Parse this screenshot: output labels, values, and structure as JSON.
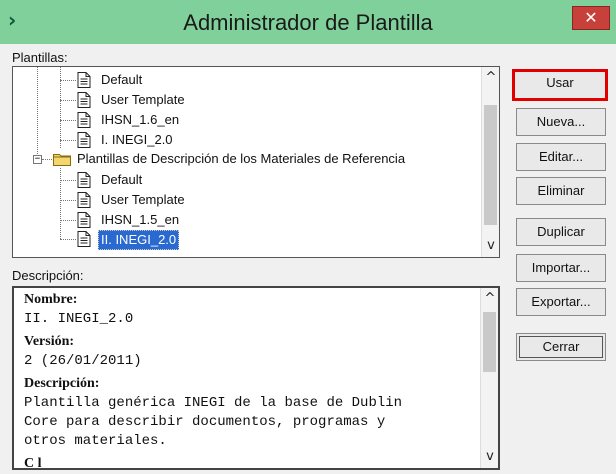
{
  "window": {
    "title": "Administrador de Plantilla",
    "close_glyph": "✕",
    "app_icon": "›"
  },
  "plantillas": {
    "label": "Plantillas:",
    "items": [
      {
        "label": "Default",
        "icon": "document-icon"
      },
      {
        "label": "User Template",
        "icon": "document-icon"
      },
      {
        "label": "IHSN_1.6_en",
        "icon": "document-icon"
      },
      {
        "label": "I. INEGI_2.0",
        "icon": "document-icon"
      },
      {
        "label": "Plantillas de Descripción de los Materiales de Referencia",
        "icon": "folder-icon"
      },
      {
        "label": "Default",
        "icon": "document-icon"
      },
      {
        "label": "User Template",
        "icon": "document-icon"
      },
      {
        "label": "IHSN_1.5_en",
        "icon": "document-icon"
      },
      {
        "label": "II. INEGI_2.0",
        "icon": "document-icon",
        "selected": true
      }
    ],
    "expander_glyph": "−"
  },
  "descripcion": {
    "label": "Descripción:",
    "nombre_head": "Nombre:",
    "nombre_val": "II. INEGI_2.0",
    "version_head": "Versión:",
    "version_val": "2 (26/01/2011)",
    "descripcion_head": "Descripción:",
    "descripcion_lines": [
      "Plantilla genérica INEGI de la base de Dublin",
      "Core para describir documentos, programas y",
      "otros materiales."
    ],
    "partial_next": "C  l"
  },
  "scroll": {
    "up": "^",
    "down": "v"
  },
  "buttons": {
    "usar": "Usar",
    "nueva": "Nueva...",
    "editar": "Editar...",
    "eliminar": "Eliminar",
    "duplicar": "Duplicar",
    "importar": "Importar...",
    "exportar": "Exportar...",
    "cerrar": "Cerrar"
  },
  "colors": {
    "titlebar": "#7fd09a",
    "close": "#c8403a",
    "selection": "#2a6ad0",
    "highlight": "#e00000"
  }
}
